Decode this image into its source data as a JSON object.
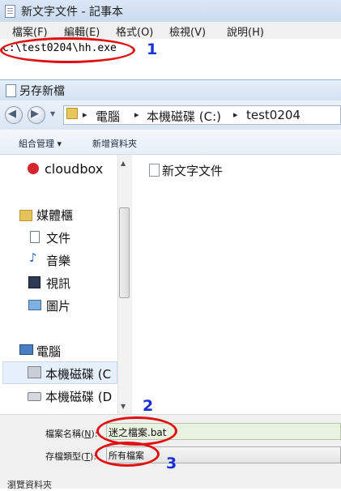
{
  "notepad": {
    "title": "新文字文件 - 記事本",
    "menus": [
      "檔案(F)",
      "編輯(E)",
      "格式(O)",
      "檢視(V)",
      "說明(H)"
    ],
    "content": "c:\\test0204\\hh.exe"
  },
  "dialog": {
    "title": "另存新檔",
    "breadcrumbs": [
      "電腦",
      "本機磁碟 (C:)",
      "test0204"
    ],
    "toolbar": {
      "organize": "組合管理 ▾",
      "new_folder": "新增資料夾"
    },
    "nav_items": {
      "cloudbox": "cloudbox",
      "libraries": "媒體櫃",
      "documents": "文件",
      "music": "音樂",
      "videos": "視訊",
      "pictures": "圖片",
      "computer": "電腦",
      "drive_c": "本機磁碟 (C",
      "drive_d": "本機磁碟 (D"
    },
    "files": [
      "新文字文件"
    ],
    "filename_label_text": "檔案名稱",
    "filename_label_key": "N",
    "filename_value": "迷之檔案.bat",
    "filetype_label_text": "存檔類型",
    "filetype_label_key": "T",
    "filetype_value": "所有檔案",
    "browse_toggle": "瀏覽資料夾"
  },
  "annotations": {
    "badge1": "1",
    "badge2": "2",
    "badge3": "3",
    "color": "#1730d8",
    "callout_color": "#e01010"
  }
}
